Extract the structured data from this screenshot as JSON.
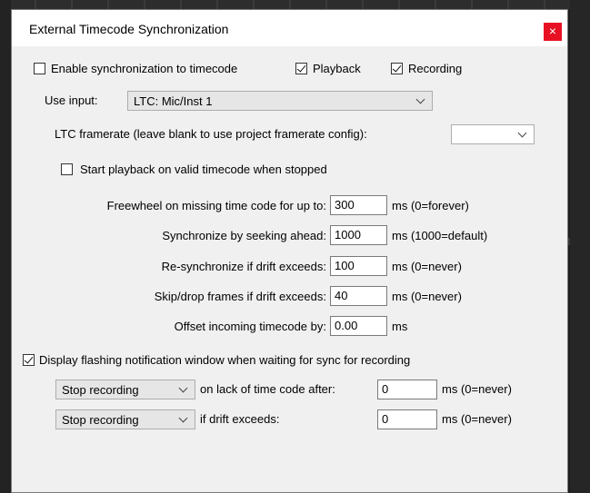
{
  "dialog": {
    "title": "External Timecode Synchronization",
    "close_label": "×"
  },
  "enable_sync": {
    "label": "Enable synchronization to timecode",
    "checked": false
  },
  "playback": {
    "label": "Playback",
    "checked": true
  },
  "recording": {
    "label": "Recording",
    "checked": true
  },
  "use_input": {
    "label": "Use input:",
    "value": "LTC: Mic/Inst 1"
  },
  "ltc_framerate": {
    "label": "LTC framerate (leave blank to use project framerate config):",
    "value": ""
  },
  "start_playback": {
    "label": "Start playback on valid timecode when stopped",
    "checked": false
  },
  "freewheel": {
    "label": "Freewheel on missing time code for up to:",
    "value": "300",
    "unit": "ms (0=forever)"
  },
  "seek_ahead": {
    "label": "Synchronize by seeking ahead:",
    "value": "1000",
    "unit": "ms (1000=default)"
  },
  "resync": {
    "label": "Re-synchronize if drift exceeds:",
    "value": "100",
    "unit": "ms (0=never)"
  },
  "skip_drop": {
    "label": "Skip/drop frames if drift exceeds:",
    "value": "40",
    "unit": "ms (0=never)"
  },
  "offset": {
    "label": "Offset incoming timecode by:",
    "value": "0.00",
    "unit": "ms"
  },
  "flash_notify": {
    "label": "Display flashing notification window when waiting for sync for recording",
    "checked": true
  },
  "lack_action": {
    "value": "Stop recording",
    "label": "on lack of time code after:",
    "input": "0",
    "unit": "ms (0=never)"
  },
  "drift_action": {
    "value": "Stop recording",
    "label": "if drift exceeds:",
    "input": "0",
    "unit": "ms (0=never)"
  }
}
